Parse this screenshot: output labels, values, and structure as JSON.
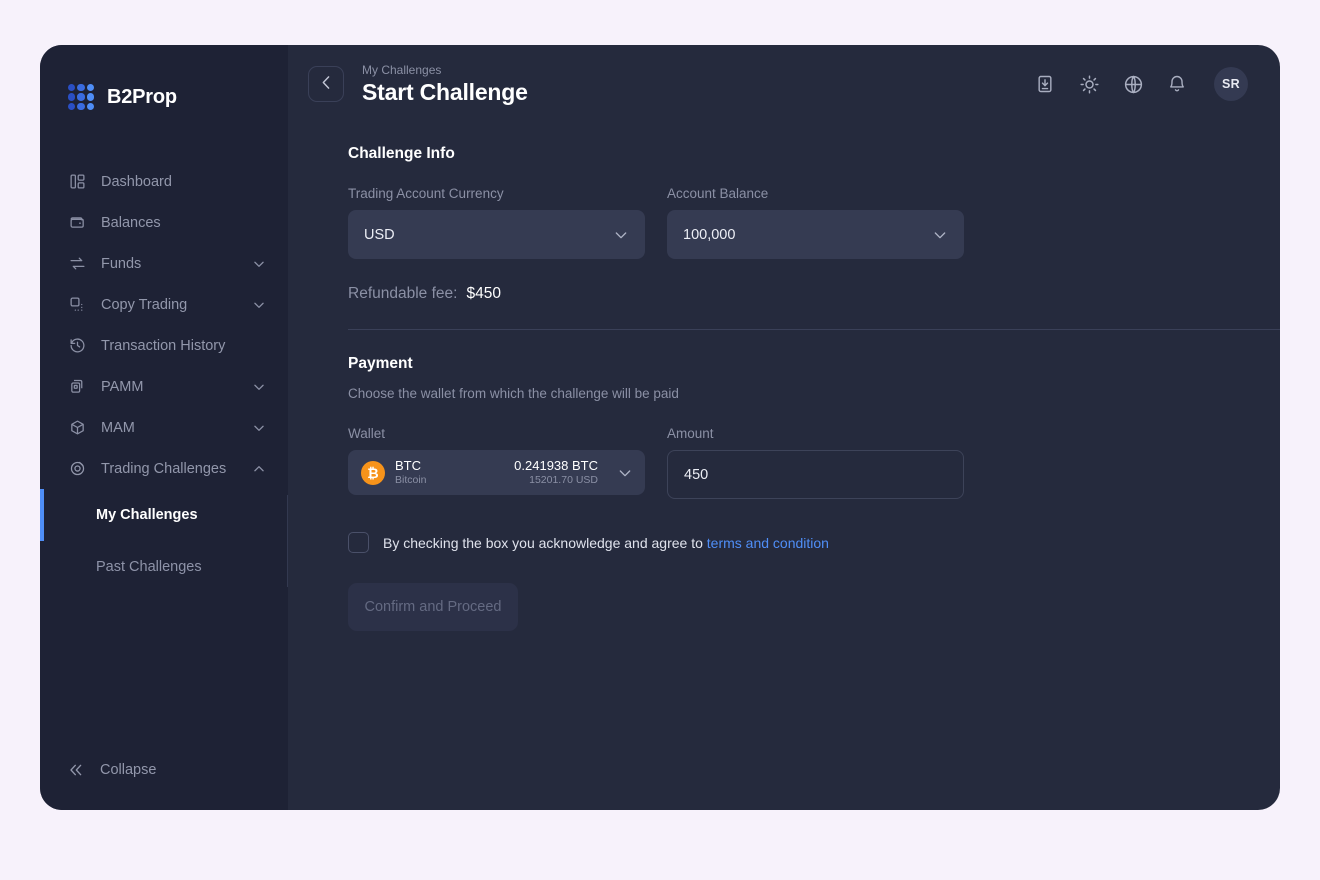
{
  "brand": {
    "name": "B2Prop",
    "logo_icon": "grid-dots-logo"
  },
  "sidebar": {
    "items": [
      {
        "label": "Dashboard",
        "icon": "dashboard-icon",
        "expandable": false
      },
      {
        "label": "Balances",
        "icon": "wallet-icon",
        "expandable": false
      },
      {
        "label": "Funds",
        "icon": "transfer-icon",
        "expandable": true
      },
      {
        "label": "Copy Trading",
        "icon": "copy-icon",
        "expandable": true
      },
      {
        "label": "Transaction History",
        "icon": "history-icon",
        "expandable": false
      },
      {
        "label": "PAMM",
        "icon": "pamm-icon",
        "expandable": true
      },
      {
        "label": "MAM",
        "icon": "cube-icon",
        "expandable": true
      },
      {
        "label": "Trading Challenges",
        "icon": "target-icon",
        "expandable": true,
        "expanded": true
      }
    ],
    "subitems": [
      {
        "label": "My Challenges",
        "active": true
      },
      {
        "label": "Past Challenges",
        "active": false
      }
    ],
    "collapse_label": "Collapse",
    "collapse_icon": "double-chevron-left-icon",
    "active_indicator_color": "#4f8ef7"
  },
  "topbar": {
    "back_icon": "chevron-left-icon",
    "breadcrumb": "My Challenges",
    "title": "Start Challenge",
    "icons": [
      "download-icon",
      "sun-icon",
      "globe-icon",
      "bell-icon"
    ],
    "avatar_initials": "SR"
  },
  "challenge_info": {
    "title": "Challenge Info",
    "currency": {
      "label": "Trading Account Currency",
      "value": "USD",
      "chevron_icon": "chevron-down-icon"
    },
    "balance": {
      "label": "Account Balance",
      "value": "100,000",
      "chevron_icon": "chevron-down-icon"
    },
    "fee_label": "Refundable fee:",
    "fee_value": "$450"
  },
  "payment": {
    "title": "Payment",
    "subtitle": "Choose the wallet from which the challenge will be paid",
    "wallet": {
      "label": "Wallet",
      "icon": "bitcoin-icon",
      "icon_glyph": "₿",
      "symbol": "BTC",
      "name": "Bitcoin",
      "amount": "0.241938 BTC",
      "usd_value": "15201.70 USD",
      "chevron_icon": "chevron-down-icon"
    },
    "amount": {
      "label": "Amount",
      "value": "450"
    },
    "terms_text": "By checking the box you acknowledge and agree to",
    "terms_link": "terms and condition",
    "confirm_label": "Confirm and Proceed"
  },
  "colors": {
    "page_bg": "#f7f2fb",
    "card_bg": "#252a3d",
    "sidebar_bg": "#1e2235",
    "accent": "#4f8ef7",
    "bitcoin": "#f7931a"
  }
}
